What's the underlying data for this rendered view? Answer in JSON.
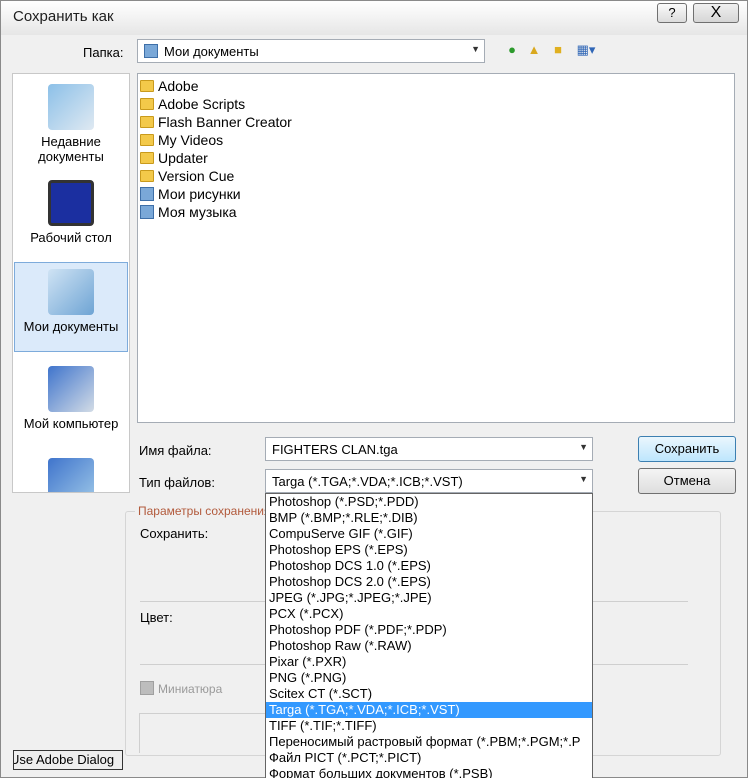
{
  "window": {
    "title": "Сохранить как"
  },
  "titlebar": {
    "help": "?",
    "close": "X"
  },
  "folder": {
    "label": "Папка:",
    "value": "Мои документы"
  },
  "places": [
    {
      "label": "Недавние документы"
    },
    {
      "label": "Рабочий стол"
    },
    {
      "label": "Мои документы"
    },
    {
      "label": "Мой компьютер"
    }
  ],
  "files": [
    {
      "name": "Adobe",
      "kind": "folder"
    },
    {
      "name": "Adobe Scripts",
      "kind": "folder"
    },
    {
      "name": "Flash Banner Creator",
      "kind": "folder"
    },
    {
      "name": "My Videos",
      "kind": "folder"
    },
    {
      "name": "Updater",
      "kind": "folder"
    },
    {
      "name": "Version Cue",
      "kind": "folder"
    },
    {
      "name": "Мои рисунки",
      "kind": "special"
    },
    {
      "name": "Моя музыка",
      "kind": "special"
    }
  ],
  "filename": {
    "label": "Имя файла:",
    "value": "FIGHTERS CLAN.tga"
  },
  "filetype": {
    "label": "Тип файлов:",
    "value": "Targa (*.TGA;*.VDA;*.ICB;*.VST)"
  },
  "buttons": {
    "save": "Сохранить",
    "cancel": "Отмена",
    "adobe_dialog": "Use Adobe Dialog"
  },
  "options": {
    "group_title": "Параметры сохранения",
    "save_label": "Сохранить:",
    "color_label": "Цвет:",
    "thumbnail_label": "Миниатюра"
  },
  "dropdown_options": [
    "Photoshop (*.PSD;*.PDD)",
    "BMP (*.BMP;*.RLE;*.DIB)",
    "CompuServe GIF (*.GIF)",
    "Photoshop EPS (*.EPS)",
    "Photoshop DCS 1.0 (*.EPS)",
    "Photoshop DCS 2.0 (*.EPS)",
    "JPEG (*.JPG;*.JPEG;*.JPE)",
    "PCX (*.PCX)",
    "Photoshop PDF (*.PDF;*.PDP)",
    "Photoshop Raw (*.RAW)",
    "Pixar (*.PXR)",
    "PNG (*.PNG)",
    "Scitex CT (*.SCT)",
    "Targa (*.TGA;*.VDA;*.ICB;*.VST)",
    "TIFF (*.TIF;*.TIFF)",
    "Переносимый растровый формат (*.PBM;*.PGM;*.P",
    "Файл PICT (*.PCT;*.PICT)",
    "Формат больших документов (*.PSB)"
  ],
  "selected_option": "Targa (*.TGA;*.VDA;*.ICB;*.VST)"
}
